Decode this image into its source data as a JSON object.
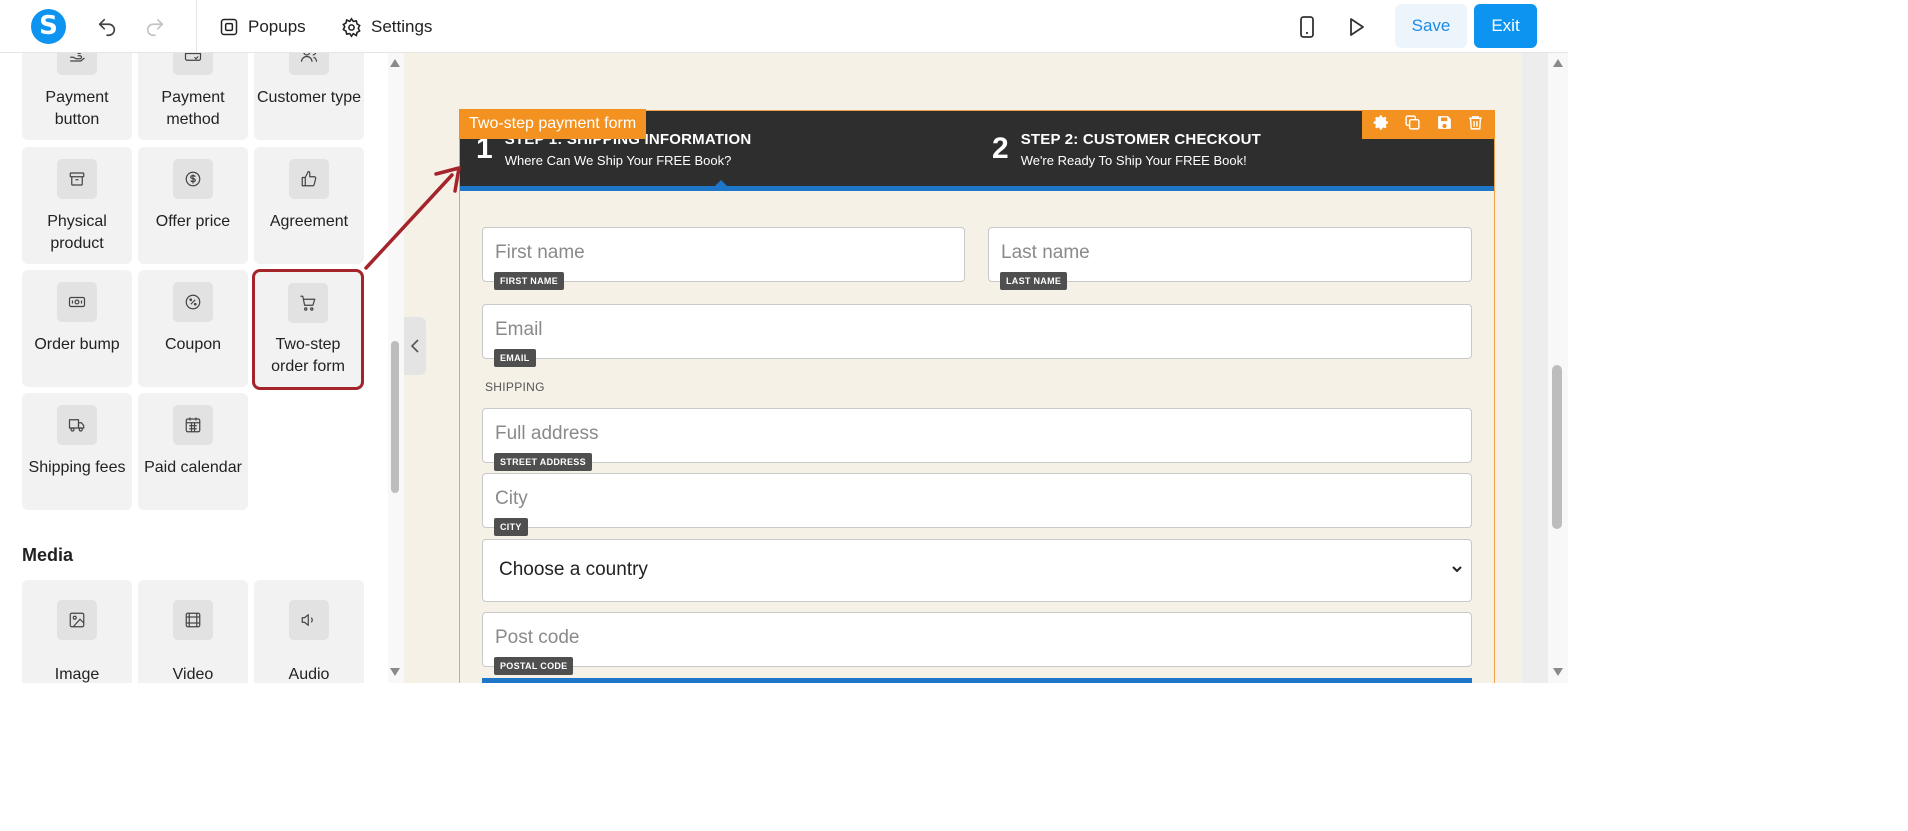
{
  "toolbar": {
    "logo_letter": "S",
    "popups_label": "Popups",
    "settings_label": "Settings",
    "save_label": "Save",
    "exit_label": "Exit"
  },
  "sidebar": {
    "tiles": [
      {
        "label": "Payment button",
        "icon": "hand-coin-icon"
      },
      {
        "label": "Payment method",
        "icon": "card-check-icon"
      },
      {
        "label": "Customer type",
        "icon": "user-group-icon"
      },
      {
        "label": "Physical product",
        "icon": "archive-box-icon"
      },
      {
        "label": "Offer price",
        "icon": "dollar-circle-icon"
      },
      {
        "label": "Agreement",
        "icon": "thumbs-up-icon"
      },
      {
        "label": "Order bump",
        "icon": "banknote-icon"
      },
      {
        "label": "Coupon",
        "icon": "percent-badge-icon"
      },
      {
        "label": "Two-step order form",
        "icon": "cart-icon"
      },
      {
        "label": "Shipping fees",
        "icon": "truck-icon"
      },
      {
        "label": "Paid calendar",
        "icon": "calendar-icon"
      }
    ],
    "media_title": "Media",
    "media_tiles": [
      {
        "label": "Image",
        "icon": "image-icon"
      },
      {
        "label": "Video",
        "icon": "film-icon"
      },
      {
        "label": "Audio",
        "icon": "speaker-icon"
      }
    ]
  },
  "form": {
    "block_tag": "Two-step payment form",
    "step1": {
      "num": "1",
      "title": "STEP 1: SHIPPING INFORMATION",
      "subtitle": "Where Can We Ship Your FREE Book?"
    },
    "step2": {
      "num": "2",
      "title": "STEP 2: CUSTOMER CHECKOUT",
      "subtitle": "We're Ready To Ship Your FREE Book!"
    },
    "first_name": {
      "placeholder": "First name",
      "badge": "FIRST NAME"
    },
    "last_name": {
      "placeholder": "Last name",
      "badge": "LAST NAME"
    },
    "email": {
      "placeholder": "Email",
      "badge": "EMAIL"
    },
    "shipping_label": "SHIPPING",
    "address": {
      "placeholder": "Full address",
      "badge": "STREET ADDRESS"
    },
    "city": {
      "placeholder": "City",
      "badge": "CITY"
    },
    "country": {
      "value": "Choose a country"
    },
    "postcode": {
      "placeholder": "Post code",
      "badge": "POSTAL CODE"
    }
  },
  "colors": {
    "brand": "#0d93f0",
    "highlight": "#a5232b",
    "block_accent": "#f39220",
    "step_bar": "#2e2e2e",
    "step_underline": "#1e76c8",
    "page_bg": "#f6f1e7"
  }
}
